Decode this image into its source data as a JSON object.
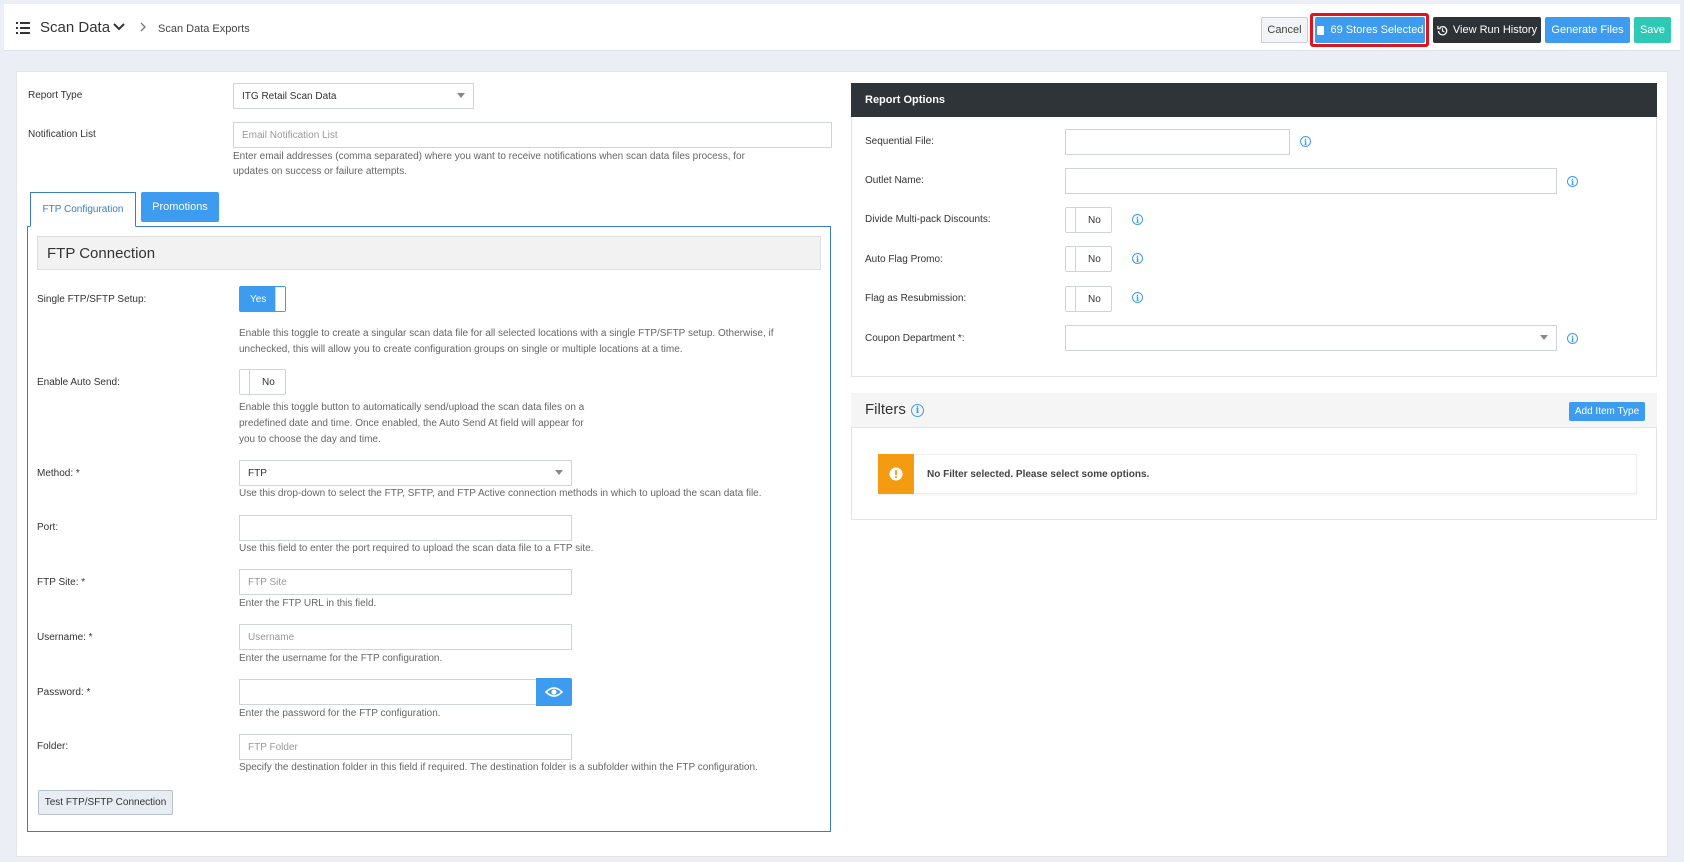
{
  "header": {
    "app_title": "Scan Data",
    "breadcrumb": "Scan Data Exports",
    "buttons": {
      "cancel": "Cancel",
      "stores_selected": "69 Stores Selected",
      "view_run_history": "View Run History",
      "generate_files": "Generate Files",
      "save": "Save"
    }
  },
  "form": {
    "report_type_label": "Report Type",
    "report_type_value": "ITG Retail Scan Data",
    "notification_label": "Notification List",
    "notification_placeholder": "Email Notification List",
    "notification_help_1": "Enter email addresses (comma separated) where you want to receive notifications when scan data files process, for",
    "notification_help_2": "updates on success or failure attempts."
  },
  "tabs": {
    "ftp": "FTP Configuration",
    "promotions": "Promotions"
  },
  "ftp": {
    "section_title": "FTP Connection",
    "single_label": "Single FTP/SFTP Setup:",
    "single_value": "Yes",
    "single_help_1": "Enable this toggle to create a singular scan data file for all selected locations with a single FTP/SFTP setup. Otherwise, if",
    "single_help_2": "unchecked, this will allow you to create configuration groups on single or multiple locations at a time.",
    "autosend_label": "Enable Auto Send:",
    "autosend_value": "No",
    "autosend_help_1": "Enable this toggle button to automatically send/upload the scan data files on a",
    "autosend_help_2": "predefined date and time. Once enabled, the Auto Send At field will appear for",
    "autosend_help_3": "you to choose the day and time.",
    "method_label": "Method: *",
    "method_value": "FTP",
    "method_help": "Use this drop-down to select the FTP, SFTP, and FTP Active connection methods in which to upload the scan data file.",
    "port_label": "Port:",
    "port_help": "Use this field to enter the port required to upload the scan data file to a FTP site.",
    "site_label": "FTP Site: *",
    "site_placeholder": "FTP Site",
    "site_help": "Enter the FTP URL in this field.",
    "username_label": "Username: *",
    "username_placeholder": "Username",
    "username_help": "Enter the username for the FTP configuration.",
    "password_label": "Password: *",
    "password_help": "Enter the password for the FTP configuration.",
    "folder_label": "Folder:",
    "folder_placeholder": "FTP Folder",
    "folder_help": "Specify the destination folder in this field if required. The destination folder is a subfolder within the FTP configuration.",
    "test_button": "Test FTP/SFTP Connection"
  },
  "report_options": {
    "title": "Report Options",
    "sequential_label": "Sequential File:",
    "outlet_label": "Outlet Name:",
    "divide_label": "Divide Multi-pack Discounts:",
    "divide_value": "No",
    "autoflag_label": "Auto Flag Promo:",
    "autoflag_value": "No",
    "resub_label": "Flag as Resubmission:",
    "resub_value": "No",
    "coupon_label": "Coupon Department *:"
  },
  "filters": {
    "title": "Filters",
    "add_button": "Add Item Type",
    "empty_message": "No Filter selected. Please select some options."
  },
  "icons": {
    "menu": "list-icon",
    "chevron": "chevron-down-icon",
    "crumb_sep": "chevron-right-icon",
    "store": "store-icon",
    "history": "history-icon",
    "eye": "eye-icon",
    "info": "info-icon",
    "warning": "warning-icon"
  }
}
